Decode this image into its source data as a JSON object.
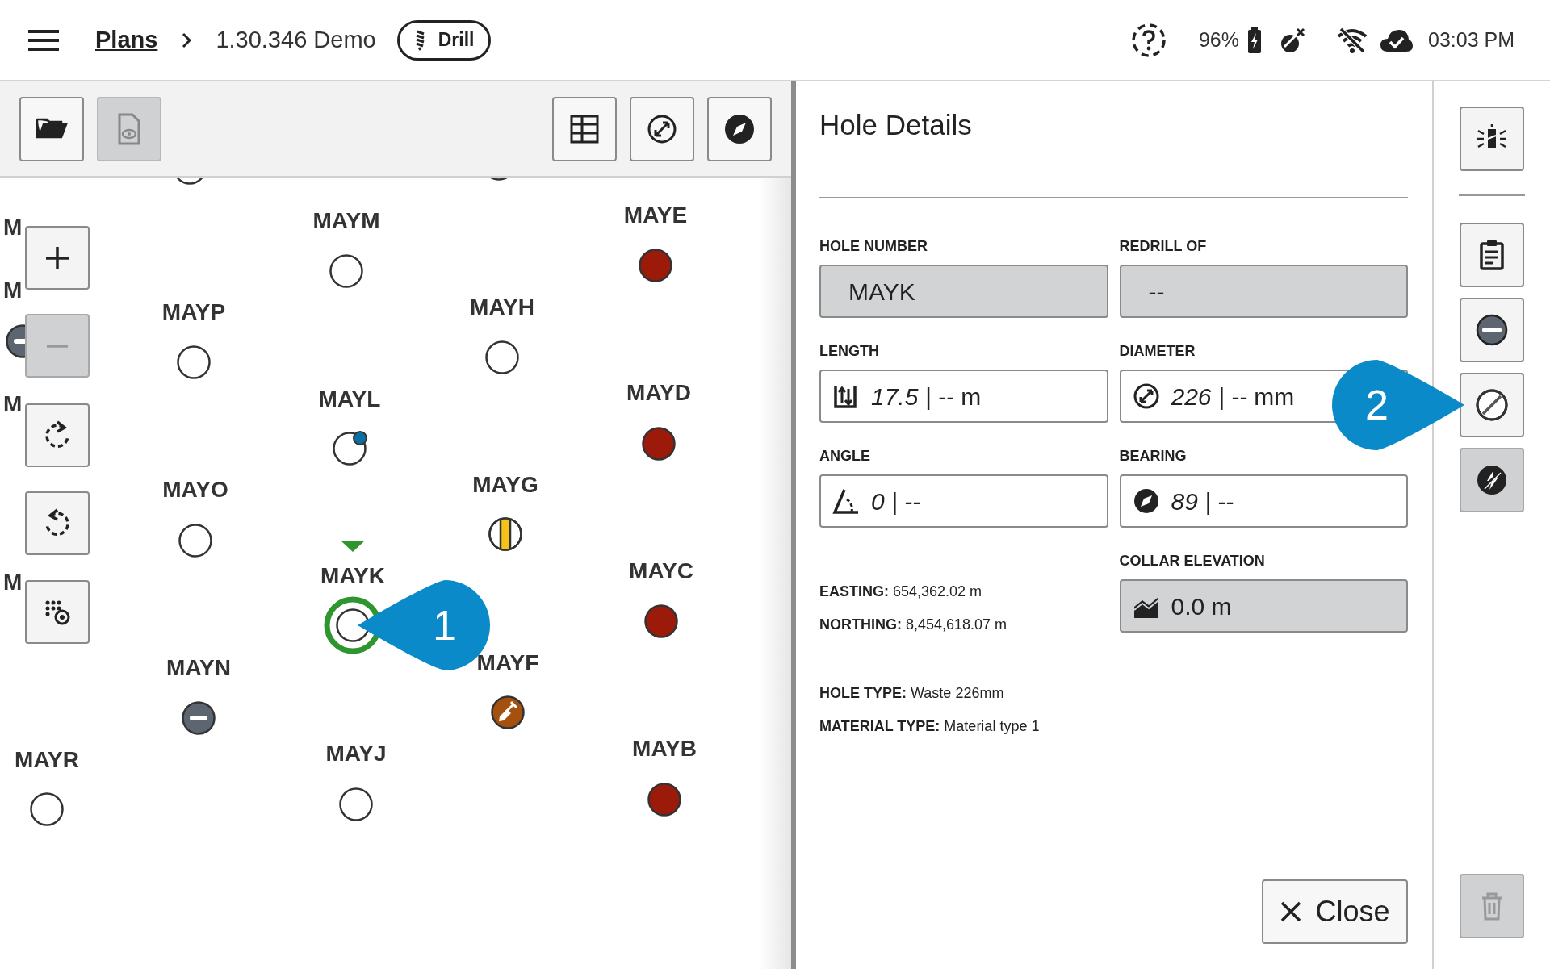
{
  "top_bar": {
    "breadcrumb": [
      {
        "label": "Plans",
        "kind": "link"
      },
      {
        "label": "1.30.346 Demo",
        "kind": "current"
      }
    ],
    "mode_badge": "Drill",
    "battery": "96%",
    "time": "03:03 PM"
  },
  "map_toolbar": [
    {
      "disabled": false
    },
    {
      "disabled": true
    },
    {
      "disabled": false
    },
    {
      "disabled": false
    },
    {
      "disabled": false
    }
  ],
  "zoom_controls": [
    {
      "disabled": false
    },
    {
      "disabled": true
    },
    {
      "disabled": false
    },
    {
      "disabled": false
    },
    {
      "disabled": false
    }
  ],
  "holes": [
    {
      "kind": "open",
      "selected": false
    },
    {
      "kind": "open",
      "selected": false
    },
    {
      "name": "M"
    },
    {
      "name": "M",
      "kind": "inactive",
      "selected": false
    },
    {
      "name": "M"
    },
    {
      "name": "M"
    },
    {
      "name": "MAYM",
      "kind": "open",
      "selected": false
    },
    {
      "name": "MAYE",
      "kind": "drilled",
      "selected": false
    },
    {
      "name": "MAYP",
      "kind": "open",
      "selected": false
    },
    {
      "name": "MAYH",
      "kind": "open",
      "selected": false
    },
    {
      "name": "MAYL",
      "kind": "flagged",
      "selected": false
    },
    {
      "name": "MAYD",
      "kind": "drilled",
      "selected": false
    },
    {
      "name": "MAYO",
      "kind": "open",
      "selected": false
    },
    {
      "name": "MAYG",
      "kind": "split",
      "selected": false
    },
    {
      "name": "MAYK",
      "kind": "open",
      "selected": true
    },
    {
      "name": "MAYC",
      "kind": "drilled",
      "selected": false
    },
    {
      "name": "MAYN",
      "kind": "inactive",
      "selected": false
    },
    {
      "name": "MAYF",
      "kind": "shovel",
      "selected": false
    },
    {
      "name": "MAYR",
      "kind": "open",
      "selected": false
    },
    {
      "name": "MAYJ",
      "kind": "open",
      "selected": false
    },
    {
      "name": "MAYB",
      "kind": "drilled",
      "selected": false
    }
  ],
  "callouts": [
    {
      "label": "1"
    },
    {
      "label": "2"
    }
  ],
  "details": {
    "title": "Hole Details",
    "fields": [
      {
        "label": "HOLE NUMBER",
        "value": "MAYK",
        "kind": "readonly"
      },
      {
        "label": "REDRILL OF",
        "value": "--",
        "kind": "readonly"
      },
      {
        "label": "LENGTH",
        "value": "*17.5 | --* m",
        "kind": "input"
      },
      {
        "label": "DIAMETER",
        "value": "*226 | --* mm",
        "kind": "input"
      },
      {
        "label": "ANGLE",
        "value": "*0 | --*",
        "kind": "input"
      },
      {
        "label": "BEARING",
        "value": "*89 | --*",
        "kind": "input"
      },
      {
        "label": "COLLAR ELEVATION",
        "value": "0.0 m",
        "kind": "readonly"
      }
    ],
    "position": [
      {
        "label": "EASTING:",
        "value": "654,362.02 m"
      },
      {
        "label": "NORTHING:",
        "value": "8,454,618.07 m"
      }
    ],
    "type_info": [
      {
        "label": "HOLE TYPE:",
        "value": "Waste 226mm"
      },
      {
        "label": "MATERIAL TYPE:",
        "value": "Material type 1"
      }
    ],
    "close": "Close"
  },
  "side_rail": [
    {
      "disabled": false
    },
    {
      "disabled": false
    },
    {
      "disabled": false
    },
    {
      "disabled": false
    },
    {
      "disabled": true
    },
    {
      "disabled": true
    }
  ]
}
